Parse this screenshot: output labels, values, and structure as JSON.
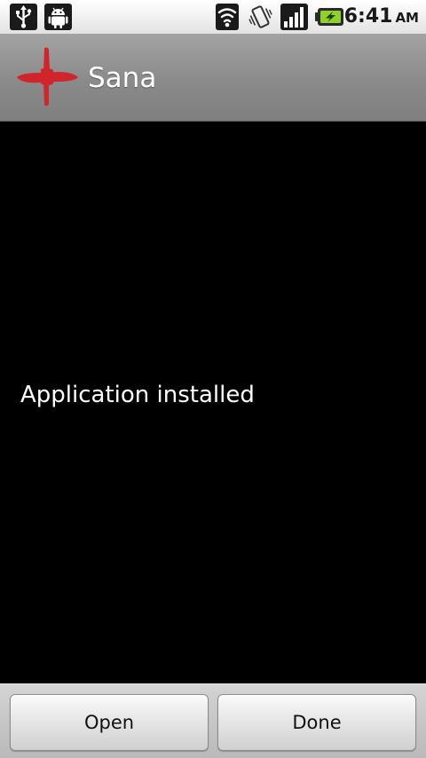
{
  "status_bar": {
    "icons": [
      "usb-icon",
      "android-debug-icon",
      "wifi-icon",
      "vibrate-icon",
      "signal-icon",
      "battery-charging-icon"
    ],
    "time": "6:41",
    "ampm": "AM"
  },
  "title_bar": {
    "app_name": "Sana",
    "logo_icon": "red-cross-logo-icon",
    "logo_color": "#d0262b"
  },
  "main": {
    "message": "Application installed"
  },
  "buttons": {
    "open_label": "Open",
    "done_label": "Done"
  }
}
